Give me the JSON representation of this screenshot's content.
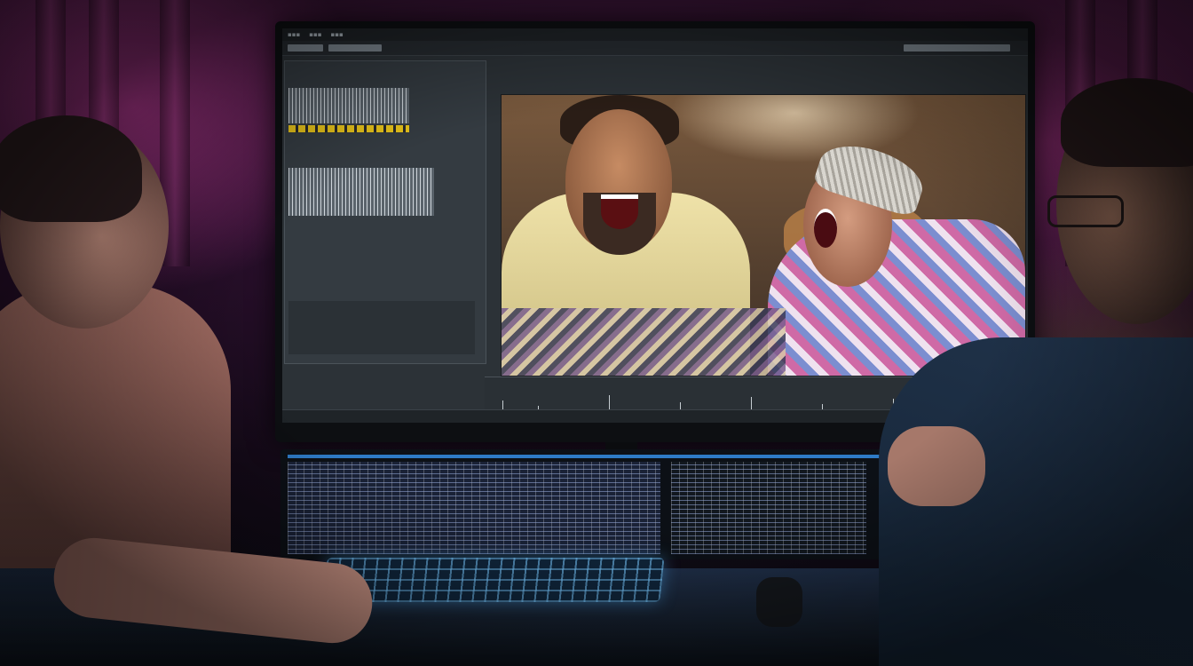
{
  "scene": {
    "description_kind": "photo",
    "accent_colors": {
      "curtain_magenta": "#ff50c8",
      "keyboard_glow": "#50b4ff",
      "timeline_yellow": "#e6c21a"
    }
  },
  "monitor_ui": {
    "icons": [
      "play-icon",
      "stop-icon",
      "record-icon"
    ]
  }
}
